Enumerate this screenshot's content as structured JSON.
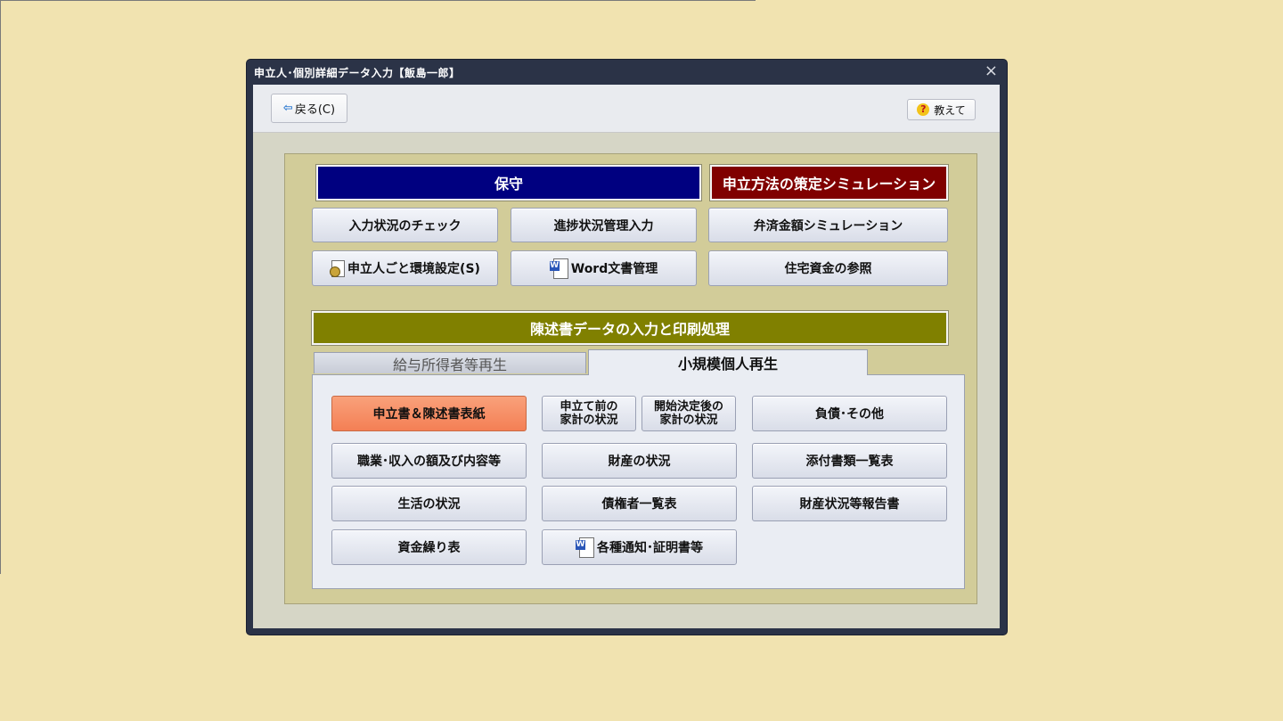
{
  "window": {
    "title": "申立人･個別詳細データ入力【飯島一郎】",
    "close_glyph": "×"
  },
  "toolbar": {
    "back_label": "戻る(C)",
    "back_icon": "arrow-left-icon",
    "help_label": "教えて",
    "help_icon": "question-icon"
  },
  "maintenance": {
    "header": "保守",
    "simulation_header": "申立方法の策定シミュレーション",
    "buttons": {
      "input_check": "入力状況のチェック",
      "progress": "進捗状況管理入力",
      "repayment_sim": "弁済金額シミュレーション",
      "env_settings": "申立人ごと環境設定(S)",
      "word_docs": "Word文書管理",
      "housing_ref": "住宅資金の参照"
    }
  },
  "statement": {
    "header": "陳述書データの入力と印刷処理",
    "tabs": [
      "給与所得者等再生",
      "小規模個人再生"
    ],
    "active_tab": "小規模個人再生",
    "buttons": {
      "cover": "申立書＆陳述書表紙",
      "before_household_1": "申立て前の",
      "before_household_2": "家計の状況",
      "after_household_1": "開始決定後の",
      "after_household_2": "家計の状況",
      "debts": "負債･その他",
      "occupation": "職業･収入の額及び内容等",
      "assets": "財産の状況",
      "attachments": "添付書類一覧表",
      "living": "生活の状況",
      "creditors": "債権者一覧表",
      "asset_report": "財産状況等報告書",
      "cashflow": "資金繰り表",
      "notices": "各種通知･証明書等"
    }
  },
  "colors": {
    "background": "#f1e3b0",
    "maintenance_header": "#000080",
    "simulation_header": "#800000",
    "statement_header": "#808000",
    "highlight_button": "#f47f55"
  }
}
